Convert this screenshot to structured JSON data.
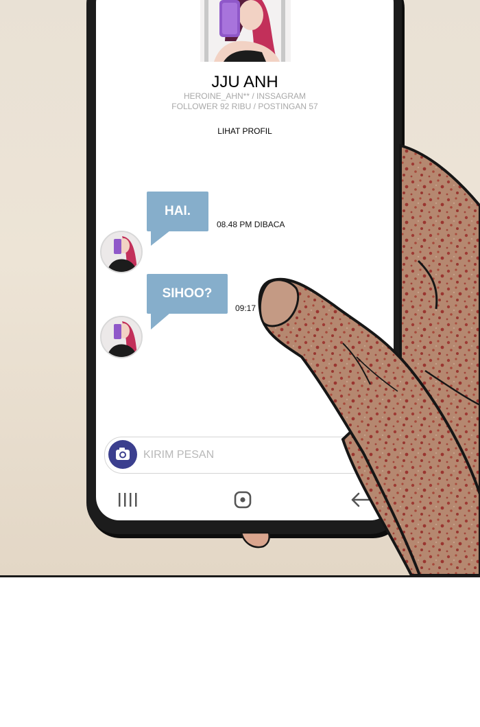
{
  "profile": {
    "name": "JJU ANH",
    "handle": "HEROINE_AHN** / INSSAGRAM",
    "stats": "FOLLOWER 92 RIBU / POSTINGAN 57",
    "view_profile": "LIHAT PROFIL"
  },
  "messages": [
    {
      "text": "HAI.",
      "time": "08.48 PM DIBACA"
    },
    {
      "text": "SIHOO?",
      "time": "09:17"
    }
  ],
  "composer": {
    "placeholder": "KIRIM PESAN",
    "camera_icon": "camera-icon"
  },
  "navbar": {
    "recents_icon": "recents-icon",
    "home_icon": "home-icon",
    "back_icon": "back-arrow-icon"
  },
  "colors": {
    "bubble": "#86aecb",
    "camera_button": "#3b3f8e",
    "accent_hair": "#c2305a"
  }
}
